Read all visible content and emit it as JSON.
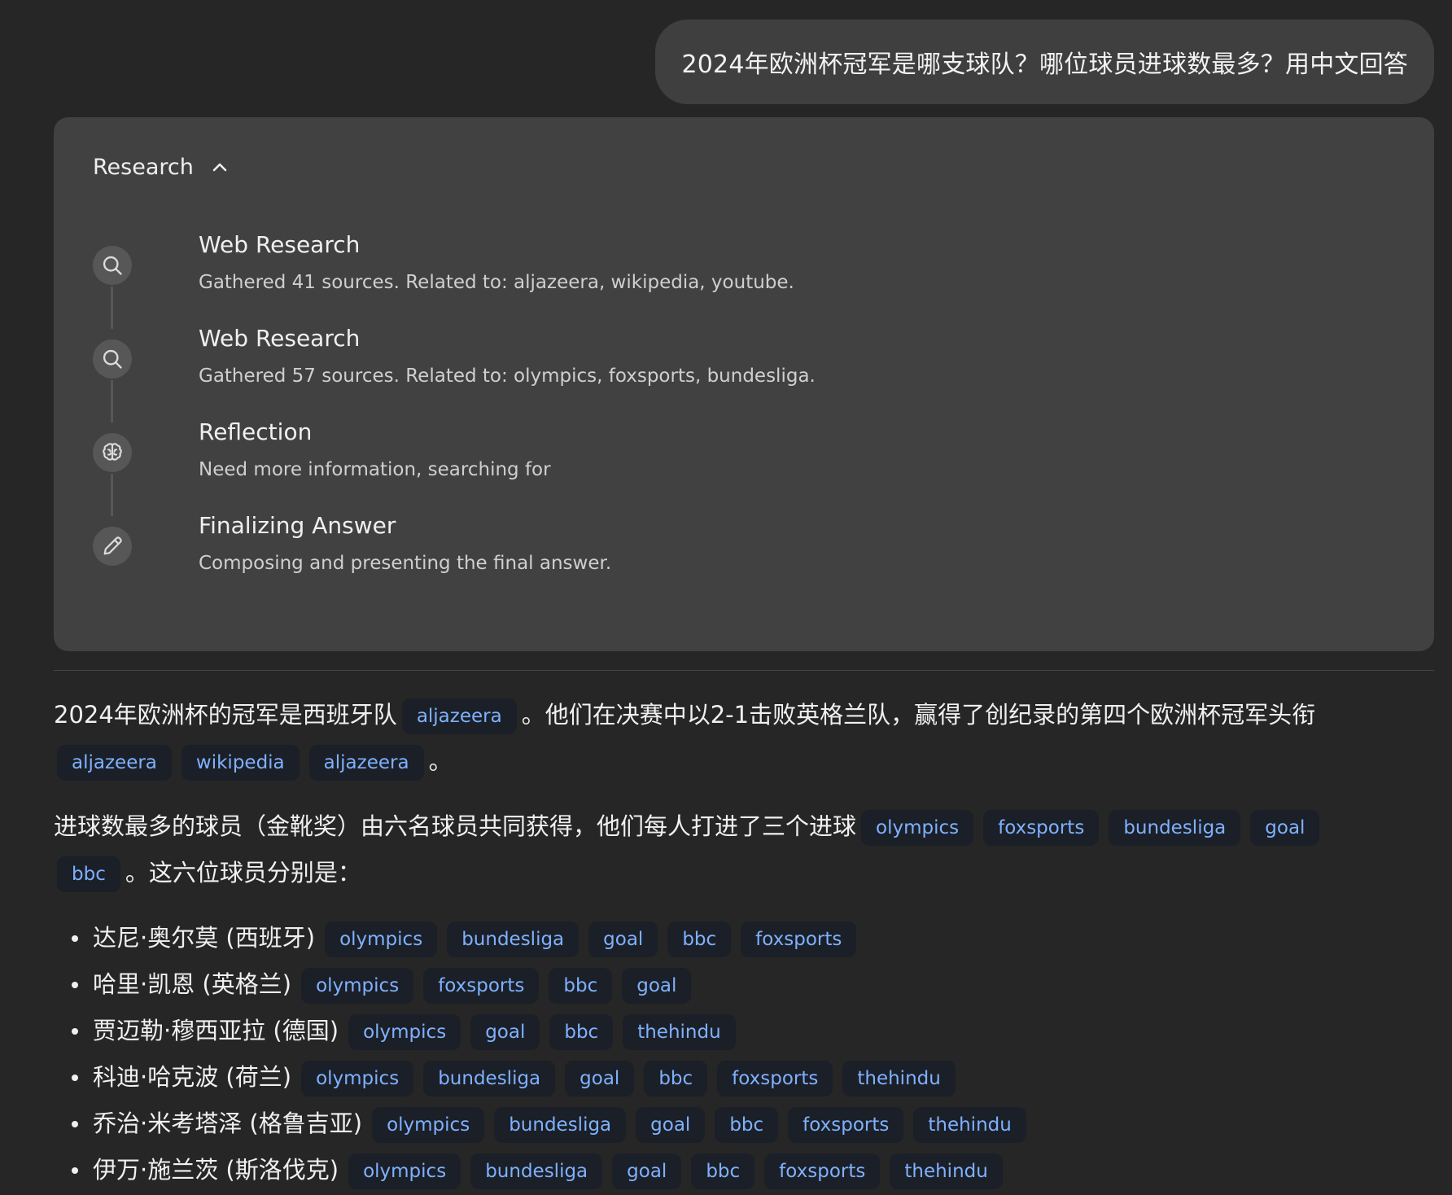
{
  "user_message": "2024年欧洲杯冠军是哪支球队？哪位球员进球数最多？用中文回答",
  "research": {
    "header": "Research",
    "steps": [
      {
        "icon": "search-icon",
        "title": "Web Research",
        "desc": "Gathered 41 sources. Related to: aljazeera, wikipedia, youtube."
      },
      {
        "icon": "search-icon",
        "title": "Web Research",
        "desc": "Gathered 57 sources. Related to: olympics, foxsports, bundesliga."
      },
      {
        "icon": "brain-icon",
        "title": "Reflection",
        "desc": "Need more information, searching for"
      },
      {
        "icon": "pencil-icon",
        "title": "Finalizing Answer",
        "desc": "Composing and presenting the final answer."
      }
    ]
  },
  "answer": {
    "p1_text_a": "2024年欧洲杯的冠军是西班牙队",
    "p1_chip_a": "aljazeera",
    "p1_text_b": "。他们在决赛中以2-1击败英格兰队，赢得了创纪录的第四个欧洲杯冠军头衔",
    "p1_chips_b": [
      "aljazeera",
      "wikipedia",
      "aljazeera"
    ],
    "p1_end": "。",
    "p2_text_a": "进球数最多的球员（金靴奖）由六名球员共同获得，他们每人打进了三个进球",
    "p2_chips": [
      "olympics",
      "foxsports",
      "bundesliga",
      "goal",
      "bbc"
    ],
    "p2_text_b": "。这六位球员分别是：",
    "players": [
      {
        "name": "达尼·奥尔莫 (西班牙)",
        "sources": [
          "olympics",
          "bundesliga",
          "goal",
          "bbc",
          "foxsports"
        ]
      },
      {
        "name": "哈里·凯恩 (英格兰)",
        "sources": [
          "olympics",
          "foxsports",
          "bbc",
          "goal"
        ]
      },
      {
        "name": "贾迈勒·穆西亚拉 (德国)",
        "sources": [
          "olympics",
          "goal",
          "bbc",
          "thehindu"
        ]
      },
      {
        "name": "科迪·哈克波 (荷兰)",
        "sources": [
          "olympics",
          "bundesliga",
          "goal",
          "bbc",
          "foxsports",
          "thehindu"
        ]
      },
      {
        "name": "乔治·米考塔泽 (格鲁吉亚)",
        "sources": [
          "olympics",
          "bundesliga",
          "goal",
          "bbc",
          "foxsports",
          "thehindu"
        ]
      },
      {
        "name": "伊万·施兰茨 (斯洛伐克)",
        "sources": [
          "olympics",
          "bundesliga",
          "goal",
          "bbc",
          "foxsports",
          "thehindu"
        ]
      }
    ]
  }
}
